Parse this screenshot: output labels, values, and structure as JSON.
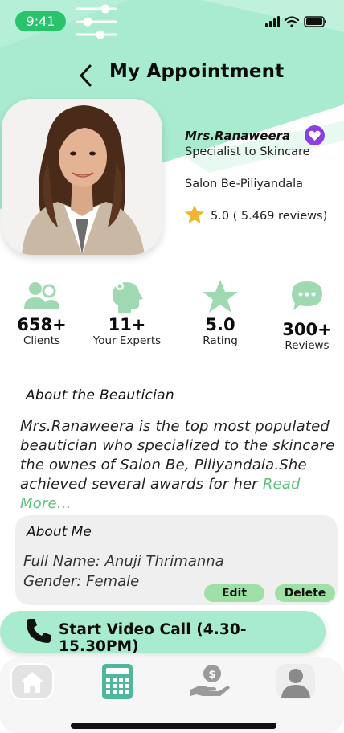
{
  "status_bar": {
    "time": "9:41"
  },
  "header": {
    "title": "My Appointment"
  },
  "profile": {
    "name": "Mrs.Ranaweera",
    "specialty": "Specialist to Skincare",
    "salon": "Salon Be-Piliyandala",
    "rating_text": "5.0 ( 5.469 reviews)"
  },
  "stats": [
    {
      "icon": "users-icon",
      "value": "658+",
      "label": "Clients"
    },
    {
      "icon": "expert-head-icon",
      "value": "11+",
      "label": "Your Experts"
    },
    {
      "icon": "star-icon",
      "value": "5.0",
      "label": "Rating"
    },
    {
      "icon": "chat-bubble-icon",
      "value": "300+",
      "label": "Reviews"
    }
  ],
  "about": {
    "title": "About the Beautician",
    "text": "Mrs.Ranaweera is the top most populated beautician who specialized to the skincare the ownes of Salon Be, Piliyandala.She achieved several awards for her ",
    "read_more": "Read More..."
  },
  "about_me": {
    "title": "About Me",
    "full_name": "Full Name: Anuji Thrimanna",
    "gender": "Gender: Female",
    "edit_label": "Edit",
    "delete_label": "Delete"
  },
  "call": {
    "label": "Start Video Call (4.30-15.30PM)"
  },
  "nav": [
    {
      "icon": "home-icon"
    },
    {
      "icon": "calculator-icon"
    },
    {
      "icon": "payment-hand-icon"
    },
    {
      "icon": "profile-icon"
    }
  ],
  "colors": {
    "mint": "#a8ebcf",
    "green_pill": "#28c36b",
    "button_green": "#9ee0a6",
    "purple": "#8b3fe0",
    "read_more": "#5cc27a",
    "star": "#f2b531",
    "stat_icon": "#9fd9b2"
  }
}
